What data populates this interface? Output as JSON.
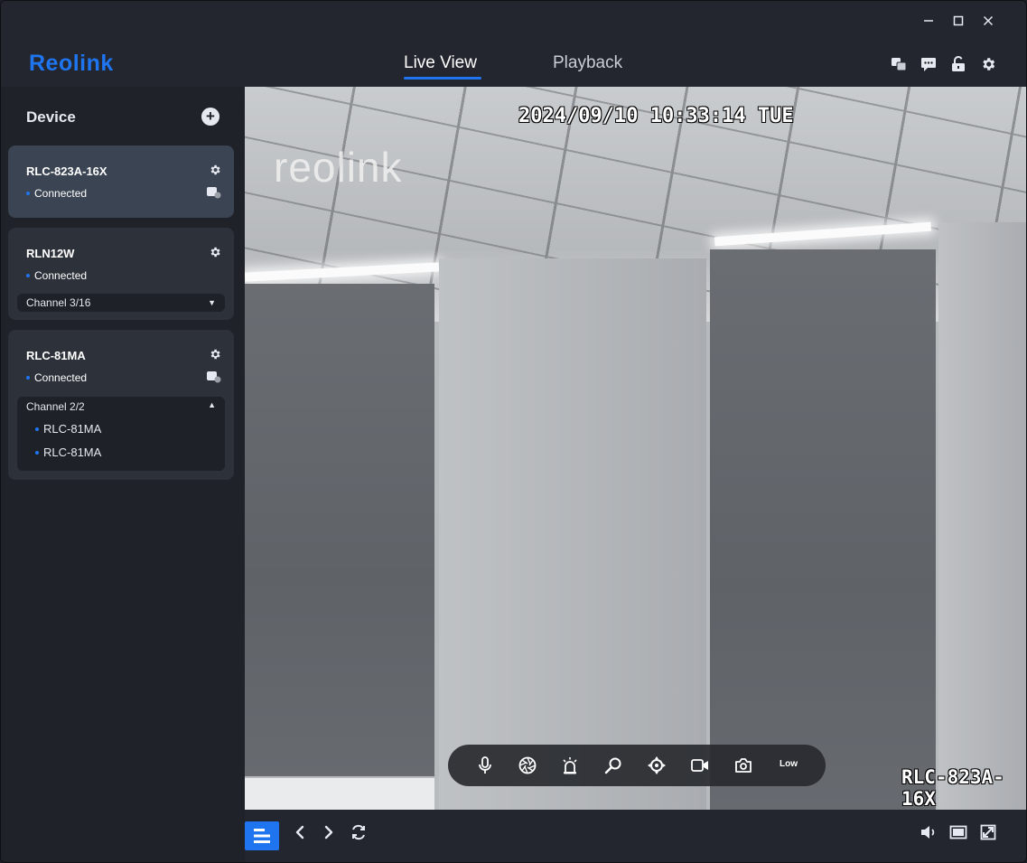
{
  "app": {
    "logo": "Reolink",
    "window_controls": {
      "minimize": "–",
      "maximize": "□",
      "close": "✕"
    }
  },
  "tabs": [
    {
      "label": "Live View",
      "active": true
    },
    {
      "label": "Playback",
      "active": false
    }
  ],
  "toolbar_icons": [
    "translate-icon",
    "message-icon",
    "lock-icon",
    "settings-icon"
  ],
  "sidebar": {
    "title": "Device",
    "add_label": "+",
    "devices": [
      {
        "name": "RLC-823A-16X",
        "status": "Connected",
        "selected": true
      },
      {
        "name": "RLN12W",
        "status": "Connected",
        "channel": "Channel 3/16",
        "channel_caret": "▼"
      },
      {
        "name": "RLC-81MA",
        "status": "Connected",
        "channel": "Channel 2/2",
        "channel_caret": "▲",
        "channels": [
          "RLC-81MA",
          "RLC-81MA"
        ]
      }
    ]
  },
  "video": {
    "timestamp": "2024/09/10 10:33:14 TUE",
    "camera_name": "RLC-823A-16X",
    "watermark": "reolink",
    "stream_quality": "Low",
    "controls": [
      "microphone-icon",
      "aperture-icon",
      "siren-icon",
      "zoom-icon",
      "ptz-icon",
      "record-icon",
      "snapshot-icon"
    ]
  },
  "bottombar": {
    "left": [
      "device-list-icon",
      "previous-icon",
      "next-icon",
      "refresh-icon"
    ],
    "right": [
      "volume-icon",
      "single-screen-icon",
      "fullscreen-icon"
    ]
  },
  "colors": {
    "accent": "#1f75f0",
    "background": "#23262e",
    "card": "#2d313a",
    "card_selected": "#3b4452"
  }
}
